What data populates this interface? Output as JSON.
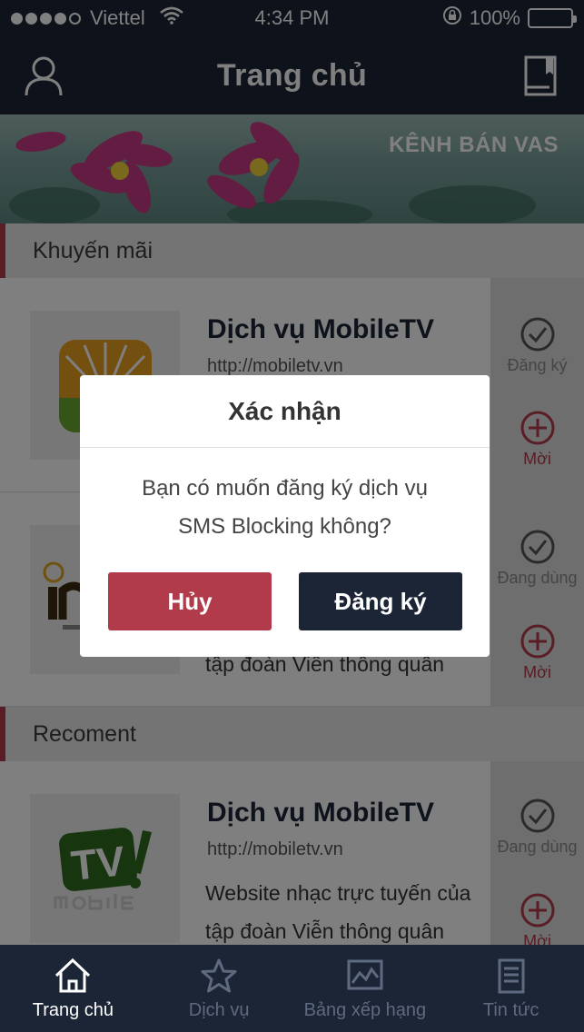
{
  "status_bar": {
    "carrier": "Viettel",
    "time": "4:34 PM",
    "battery": "100%",
    "signal_bars": 4
  },
  "header": {
    "title": "Trang chủ",
    "left_icon": "user-icon",
    "right_icon": "book-icon"
  },
  "banner": {
    "label": "KÊNH BÁN VAS"
  },
  "sections": [
    {
      "title": "Khuyến mãi",
      "items": [
        {
          "name": "Dịch vụ MobileTV",
          "url": "http://mobiletv.vn",
          "desc": "",
          "action1": "Đăng ký",
          "action2": "Mời"
        },
        {
          "name": "",
          "url": "",
          "desc": "tập đoàn Viễn thông quân",
          "action1": "Đang dùng",
          "action2": "Mời"
        }
      ]
    },
    {
      "title": "Recoment",
      "items": [
        {
          "name": "Dịch vụ MobileTV",
          "url": "http://mobiletv.vn",
          "desc": "Website nhạc trực tuyến của tập đoàn Viễn thông quân",
          "action1": "Đang dùng",
          "action2": "Mời"
        }
      ]
    }
  ],
  "dialog": {
    "title": "Xác nhận",
    "message_line1": "Bạn có muốn đăng ký dịch vụ",
    "message_line2": "SMS Blocking không?",
    "cancel_label": "Hủy",
    "confirm_label": "Đăng ký"
  },
  "tabbar": {
    "items": [
      {
        "label": "Trang chủ",
        "icon": "home-icon",
        "active": true
      },
      {
        "label": "Dịch vụ",
        "icon": "star-icon",
        "active": false
      },
      {
        "label": "Bảng xếp hạng",
        "icon": "chart-icon",
        "active": false
      },
      {
        "label": "Tin tức",
        "icon": "news-icon",
        "active": false
      }
    ]
  },
  "colors": {
    "navy": "#1b2536",
    "accent_red": "#b23b4b",
    "action_bg": "#dcdcdc"
  }
}
